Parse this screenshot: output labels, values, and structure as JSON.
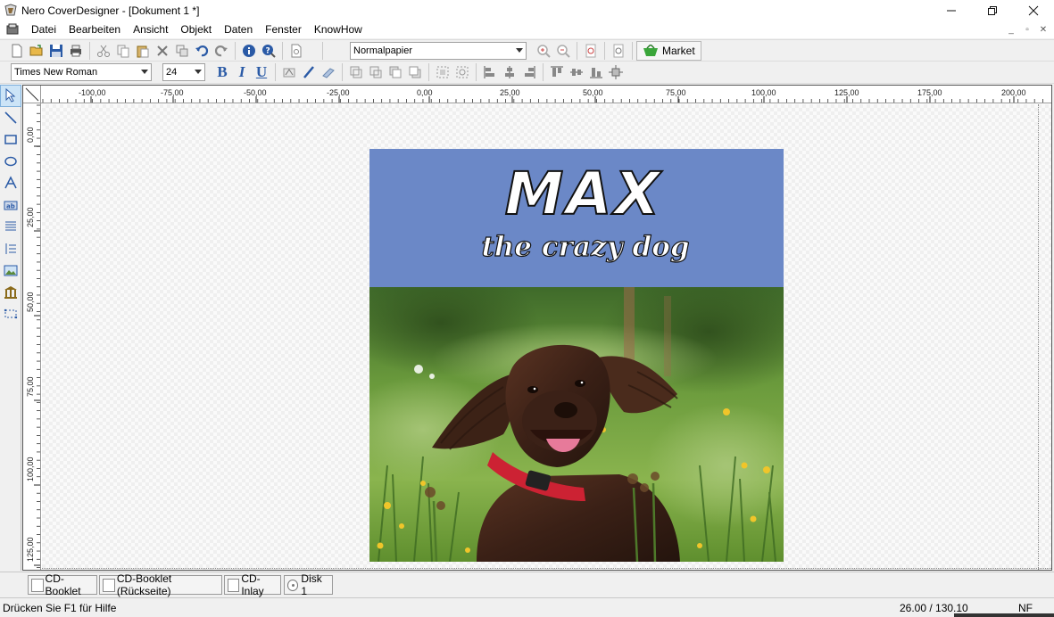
{
  "window": {
    "title": "Nero CoverDesigner - [Dokument 1 *]",
    "app_icon": "nero-coverdesigner-icon"
  },
  "menu": {
    "items": [
      "Datei",
      "Bearbeiten",
      "Ansicht",
      "Objekt",
      "Daten",
      "Fenster",
      "KnowHow"
    ]
  },
  "toolbar": {
    "paper_type": "Normalpapier",
    "market_label": "Market"
  },
  "format": {
    "font_family": "Times New Roman",
    "font_size": "24",
    "bold_label": "B",
    "italic_label": "I",
    "underline_label": "U"
  },
  "rulers": {
    "horizontal_labels": [
      "-100,00",
      "-75,00",
      "-50,00",
      "-25,00",
      "0,00",
      "25,00",
      "50,00",
      "75,00",
      "100,00",
      "125,00",
      "175,00",
      "200,00"
    ],
    "vertical_labels": [
      "0,00",
      "25,00",
      "50,00",
      "75,00",
      "100,00",
      "125,00"
    ]
  },
  "cover": {
    "title": "MAX",
    "subtitle": "the crazy dog",
    "header_color": "#6b88c7",
    "photo": "dog-photo"
  },
  "tabs": [
    {
      "label": "CD-Booklet",
      "icon": "page-icon"
    },
    {
      "label": "CD-Booklet (Rückseite)",
      "icon": "page-icon"
    },
    {
      "label": "CD-Inlay",
      "icon": "page-icon"
    },
    {
      "label": "Disk 1",
      "icon": "disc-icon"
    }
  ],
  "status": {
    "hint": "Drücken Sie F1 für Hilfe",
    "coords": "26.00 / 130.10",
    "mode": "NF"
  }
}
